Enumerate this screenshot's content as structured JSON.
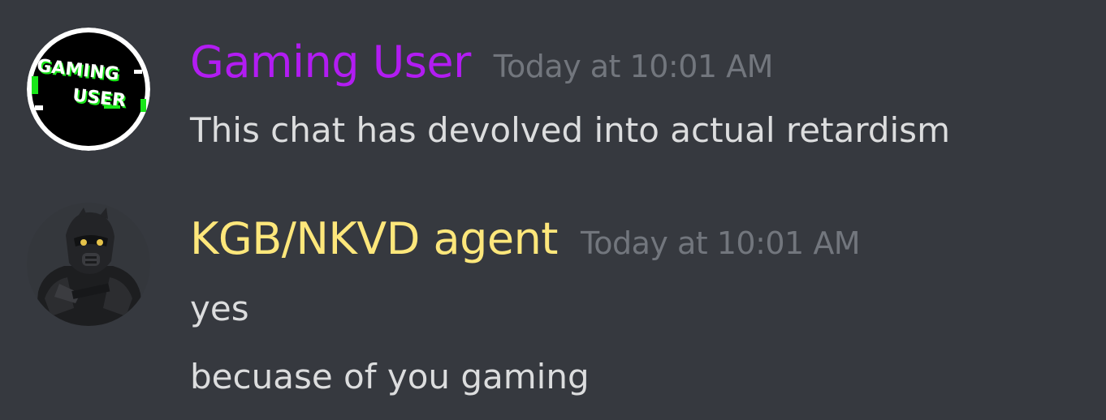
{
  "colors": {
    "background": "#36393f",
    "timestamp": "#72767d",
    "message_text": "#dcddde"
  },
  "messages": [
    {
      "author": "Gaming User",
      "author_color": "#b21cf2",
      "timestamp": "Today at 10:01 AM",
      "avatar": {
        "icon": "gaming-user-logo-avatar",
        "line1": "GAMING",
        "line2": "USER"
      },
      "lines": [
        "This chat has devolved into actual retardism"
      ]
    },
    {
      "author": "KGB/NKVD agent",
      "author_color": "#fee77b",
      "timestamp": "Today at 10:01 AM",
      "avatar": {
        "icon": "armored-soldier-avatar"
      },
      "lines": [
        "yes",
        "becuase of you gaming"
      ]
    }
  ]
}
